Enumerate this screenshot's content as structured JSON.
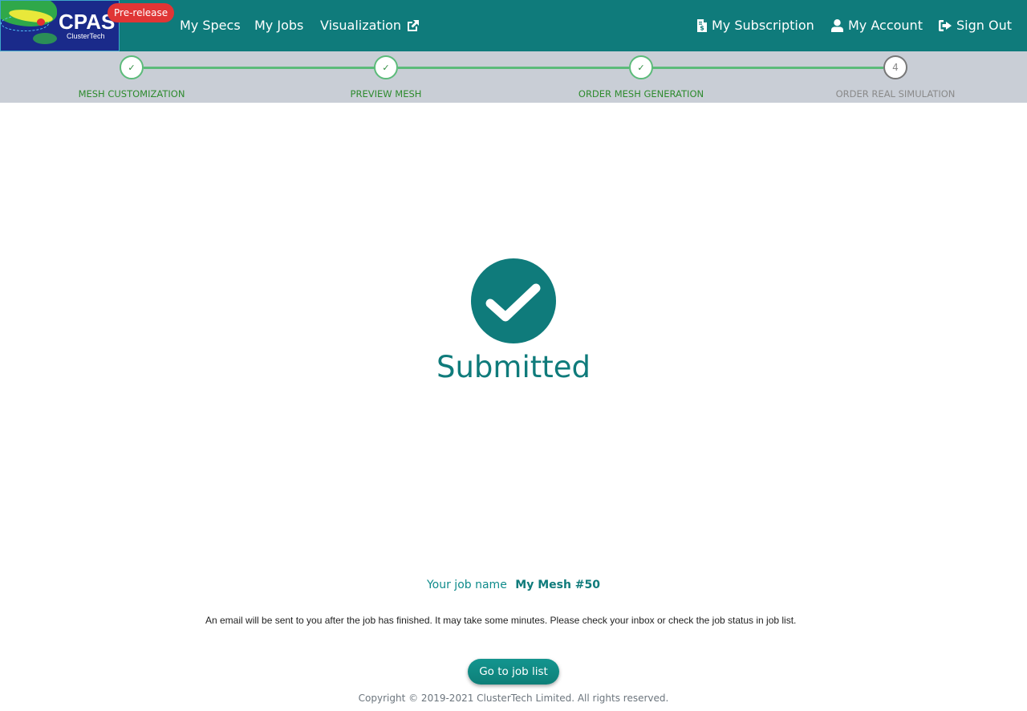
{
  "brand": {
    "name": "CPAS",
    "subtitle": "ClusterTech",
    "badge": "Pre-release"
  },
  "nav": {
    "left": [
      {
        "label": "My Specs"
      },
      {
        "label": "My Jobs"
      },
      {
        "label": "Visualization",
        "icon": "external-link-icon"
      }
    ],
    "right": [
      {
        "label": "My Subscription",
        "icon": "invoice-dollar-icon"
      },
      {
        "label": "My Account",
        "icon": "user-icon"
      },
      {
        "label": "Sign Out",
        "icon": "sign-out-icon"
      }
    ]
  },
  "stepper": {
    "steps": [
      {
        "label": "MESH CUSTOMIZATION",
        "marker": "✓",
        "status": "completed"
      },
      {
        "label": "PREVIEW MESH",
        "marker": "✓",
        "status": "completed"
      },
      {
        "label": "ORDER MESH GENERATION",
        "marker": "✓",
        "status": "completed"
      },
      {
        "label": "ORDER REAL SIMULATION",
        "marker": "4",
        "status": "pending"
      }
    ]
  },
  "main": {
    "status_title": "Submitted",
    "job_name_label": "Your job name",
    "job_name_value": "My Mesh #50",
    "email_note": "An email will be sent to you after the job has finished. It may take some minutes. Please check your inbox or check the job status in job list.",
    "go_button_label": "Go to job list"
  },
  "footer": {
    "copyright": "Copyright © 2019-2021 ClusterTech Limited. All rights reserved."
  },
  "colors": {
    "primary": "#0f7b7b",
    "badge": "#e03535",
    "step_complete": "#5cbb7a",
    "stepper_bg": "#c9ced6"
  }
}
